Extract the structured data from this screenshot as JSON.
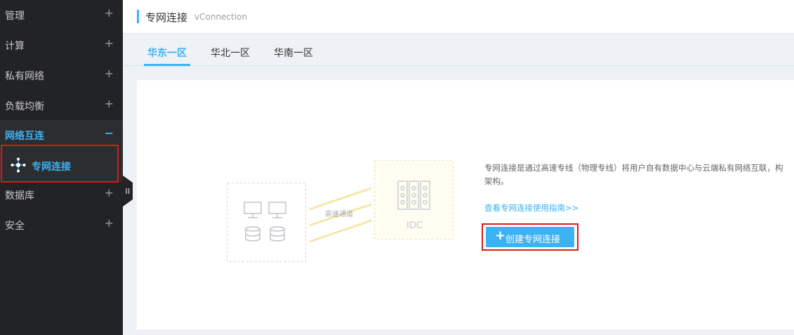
{
  "sidebar": {
    "items": [
      {
        "label": "管理",
        "toggle": "+"
      },
      {
        "label": "计算",
        "toggle": "+"
      },
      {
        "label": "私有网络",
        "toggle": "+"
      },
      {
        "label": "负载均衡",
        "toggle": "+"
      },
      {
        "label": "网络互连",
        "toggle": "−"
      },
      {
        "label": "数据库",
        "toggle": "+"
      },
      {
        "label": "安全",
        "toggle": "+"
      }
    ],
    "sub_item": {
      "label": "专网连接",
      "icon": "network-node-icon"
    }
  },
  "header": {
    "title": "专网连接",
    "subtitle": "vConnection"
  },
  "tabs": [
    {
      "label": "华东一区"
    },
    {
      "label": "华北一区"
    },
    {
      "label": "华南一区"
    }
  ],
  "diagram": {
    "channel_label": "高速通道",
    "idc_label": "IDC"
  },
  "content": {
    "description_line1": "专网连接是通过高速专线（物理专线）将用户自有数据中心与云端私有网络互联，构",
    "description_line2": "架构。",
    "guide_link": "查看专网连接使用指南>>",
    "create_button": "创建专网连接",
    "create_icon": "+"
  },
  "colors": {
    "accent": "#3db2f2",
    "sidebar_bg": "#222326",
    "highlight_border": "#d9191c"
  }
}
